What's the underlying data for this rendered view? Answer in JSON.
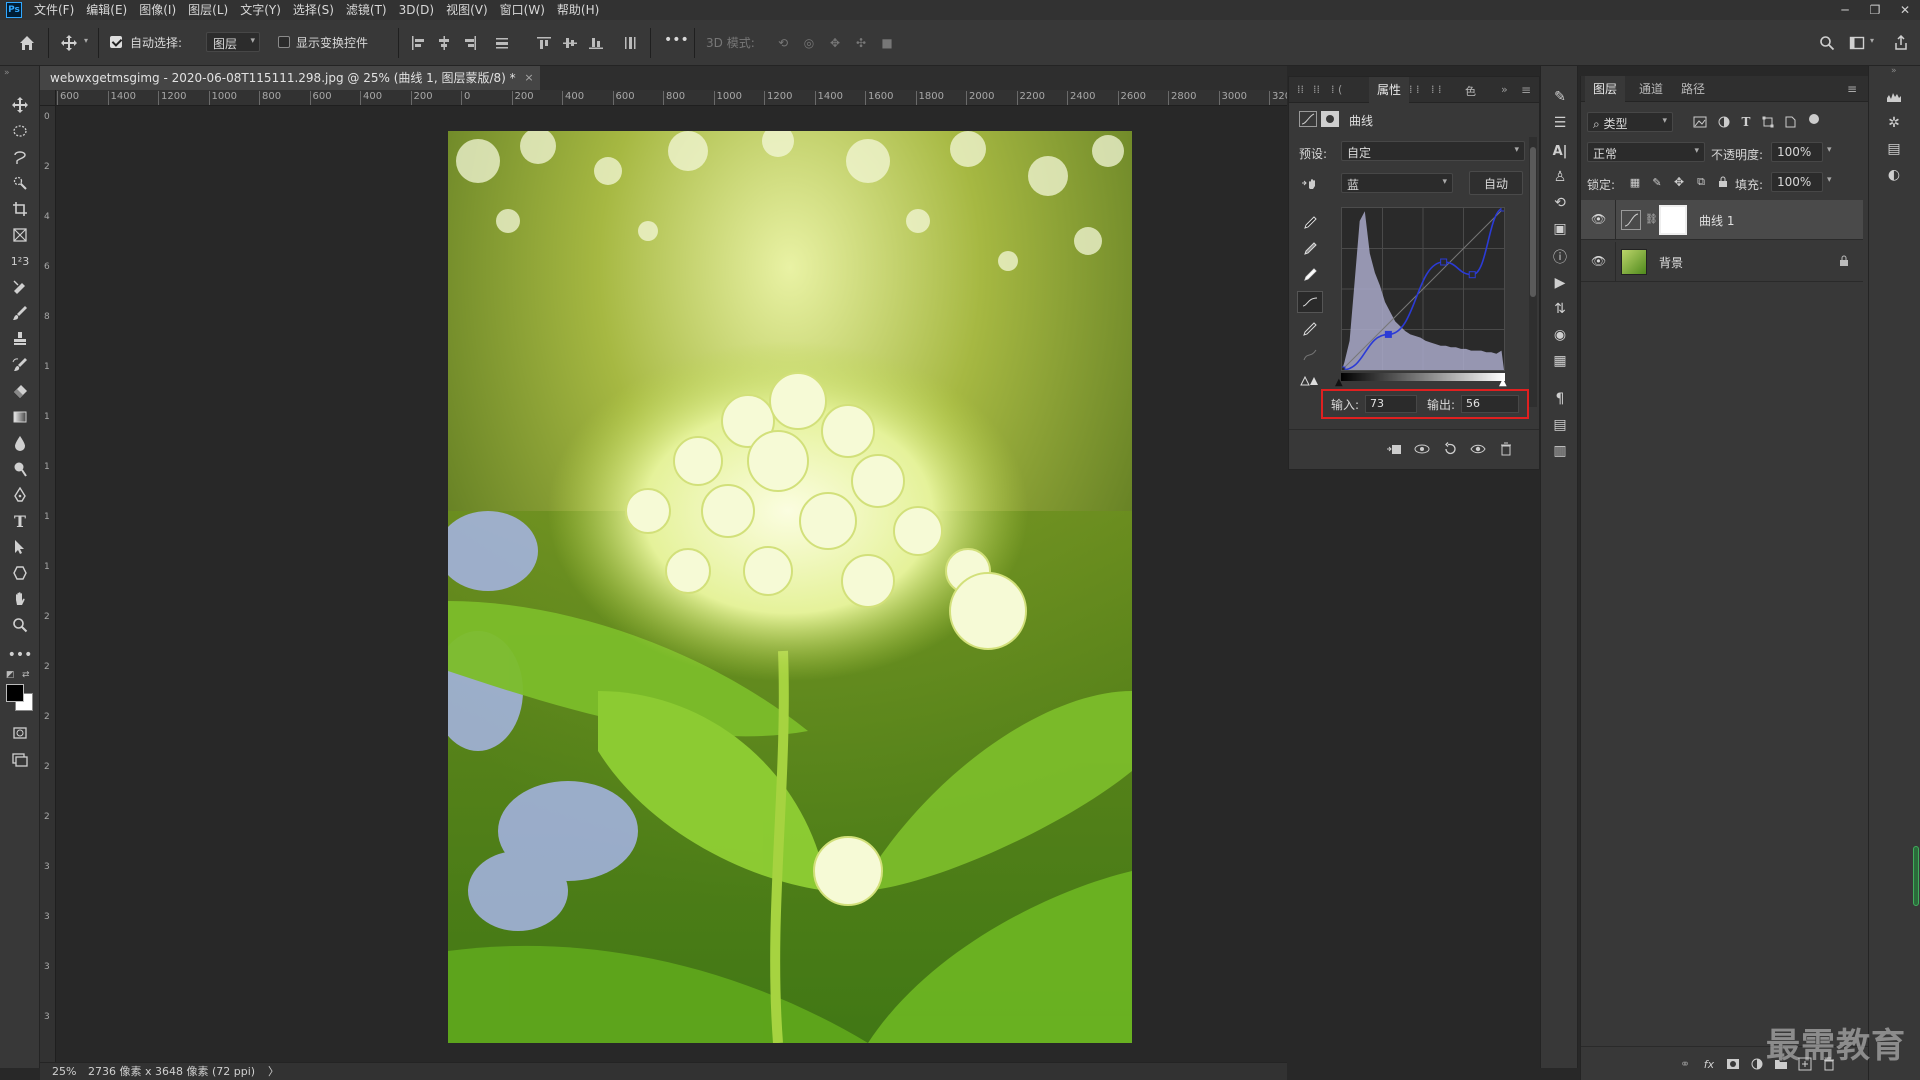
{
  "app": {
    "logo_text": "Ps"
  },
  "menu": [
    "文件(F)",
    "编辑(E)",
    "图像(I)",
    "图层(L)",
    "文字(Y)",
    "选择(S)",
    "滤镜(T)",
    "3D(D)",
    "视图(V)",
    "窗口(W)",
    "帮助(H)"
  ],
  "window_controls": {
    "minimize": "─",
    "restore": "❐",
    "close": "✕"
  },
  "options_bar": {
    "auto_select_label": "自动选择:",
    "auto_select_checked": true,
    "auto_select_target": "图层",
    "show_transform_label": "显示变换控件",
    "show_transform_checked": false,
    "more_label": "•••",
    "mode_3d_label": "3D 模式:"
  },
  "document": {
    "tab_title": "webwxgetmsgimg - 2020-06-08T115111.298.jpg @ 25% (曲线 1, 图层蒙版/8) *",
    "close_glyph": "×",
    "ruler_h_labels": [
      "600",
      "1400",
      "1200",
      "1000",
      "800",
      "600",
      "400",
      "200",
      "0",
      "200",
      "400",
      "600",
      "800",
      "1000",
      "1200",
      "1400",
      "1600",
      "1800",
      "2000",
      "2200",
      "2400",
      "2600",
      "2800",
      "3000",
      "3200"
    ],
    "ruler_v_labels": [
      "0",
      "2",
      "4",
      "6",
      "8",
      "1",
      "1",
      "1",
      "1",
      "1",
      "2",
      "2",
      "2",
      "2",
      "2",
      "3",
      "3",
      "3",
      "3",
      "3"
    ]
  },
  "status": {
    "zoom": "25%",
    "doc_info": "2736 像素 x 3648 像素 (72 ppi)",
    "arrow": "〉"
  },
  "properties": {
    "tab_label": "属性",
    "extra_tab_label": "色",
    "adjustment_name": "曲线",
    "preset_label": "预设:",
    "preset_value": "自定",
    "channel_value": "蓝",
    "auto_button": "自动",
    "input_label": "输入:",
    "input_value": "73",
    "output_label": "输出:",
    "output_value": "56",
    "curve_points": [
      [
        0,
        0
      ],
      [
        73,
        56
      ],
      [
        160,
        170
      ],
      [
        205,
        150
      ],
      [
        255,
        255
      ]
    ],
    "histogram": [
      0.05,
      0.18,
      0.55,
      0.92,
      0.98,
      0.72,
      0.6,
      0.52,
      0.42,
      0.36,
      0.3,
      0.27,
      0.24,
      0.22,
      0.21,
      0.2,
      0.18,
      0.17,
      0.16,
      0.15,
      0.15,
      0.14,
      0.14,
      0.13,
      0.13,
      0.12,
      0.12,
      0.12,
      0.11,
      0.11,
      0.1,
      0.12
    ]
  },
  "layers": {
    "tabs": [
      "图层",
      "通道",
      "路径"
    ],
    "filter_label": "类型",
    "blend_mode": "正常",
    "opacity_label": "不透明度:",
    "opacity_value": "100%",
    "lock_label": "锁定:",
    "fill_label": "填充:",
    "fill_value": "100%",
    "items": [
      {
        "name": "曲线 1",
        "selected": true
      },
      {
        "name": "背景",
        "selected": false
      }
    ],
    "footer_icons": [
      "link-icon",
      "fx-icon",
      "mask-icon",
      "adjustment-icon",
      "group-icon",
      "new-layer-icon",
      "trash-icon"
    ]
  },
  "watermark": "最需教育",
  "colors": {
    "accent_red": "#e02020",
    "curve_blue": "#2b3bd6",
    "panel_bg": "#383838"
  }
}
